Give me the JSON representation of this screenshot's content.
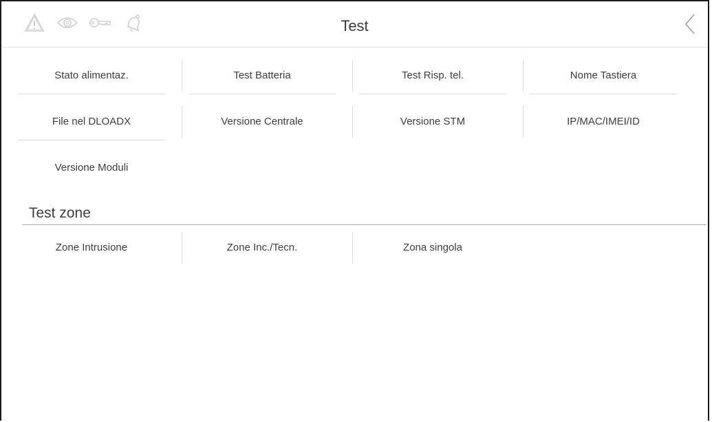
{
  "header": {
    "title": "Test",
    "icons": [
      "alarm-warning-icon",
      "eye-icon",
      "key-icon",
      "bell-icon"
    ],
    "back_icon": "chevron-left-icon"
  },
  "menu": {
    "row1": [
      "Stato alimentaz.",
      "Test Batteria",
      "Test Risp. tel.",
      "Nome Tastiera"
    ],
    "row2": [
      "File nel DLOADX",
      "Versione Centrale",
      "Versione STM",
      "IP/MAC/IMEI/ID"
    ],
    "row3": [
      "Versione Moduli"
    ]
  },
  "test_zone": {
    "title": "Test zone",
    "items": [
      "Zone Intrusione",
      "Zone Inc./Tecn.",
      "Zona singola"
    ]
  },
  "colors": {
    "text": "#3d3d3d",
    "divider": "#dcdcdc",
    "icon": "#cfcfcf"
  }
}
